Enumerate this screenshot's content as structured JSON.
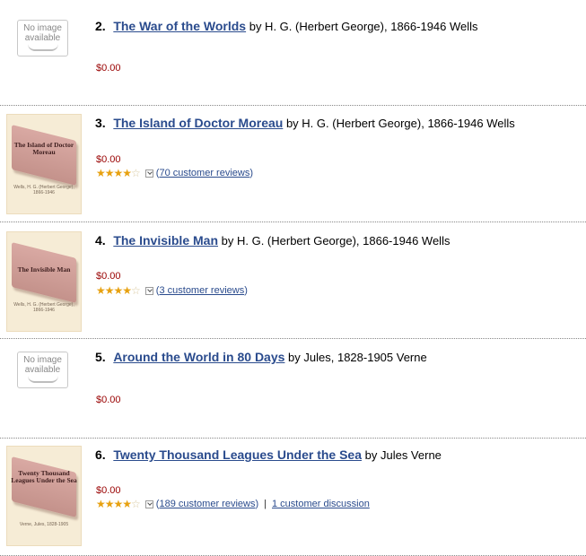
{
  "results": [
    {
      "rank": "2.",
      "title": "The War of the Worlds",
      "author": "by H. G. (Herbert George), 1866-1946 Wells",
      "price": "$0.00",
      "thumb": {
        "type": "no-image",
        "text1": "No image",
        "text2": "available"
      }
    },
    {
      "rank": "3.",
      "title": "The Island of Doctor Moreau",
      "author": "by H. G. (Herbert George), 1866-1946 Wells",
      "price": "$0.00",
      "stars": "★★★★",
      "stars_dim": "☆",
      "rating": 4.5,
      "reviews": "70 customer reviews",
      "thumb": {
        "type": "book",
        "title": "The Island of Doctor Moreau",
        "author": "Wells, H. G. (Herbert George), 1866-1946"
      }
    },
    {
      "rank": "4.",
      "title": "The Invisible Man",
      "author": "by H. G. (Herbert George), 1866-1946 Wells",
      "price": "$0.00",
      "stars": "★★★★",
      "stars_dim": "☆",
      "rating": 4.5,
      "reviews": "3 customer reviews",
      "thumb": {
        "type": "book",
        "title": "The Invisible Man",
        "author": "Wells, H. G. (Herbert George), 1866-1946"
      }
    },
    {
      "rank": "5.",
      "title": "Around the World in 80 Days",
      "author": "by Jules, 1828-1905 Verne",
      "price": "$0.00",
      "thumb": {
        "type": "no-image",
        "text1": "No image",
        "text2": "available"
      }
    },
    {
      "rank": "6.",
      "title": "Twenty Thousand Leagues Under the Sea",
      "author": "by Jules Verne",
      "price": "$0.00",
      "stars": "★★★★",
      "stars_dim": "☆",
      "rating": 4.0,
      "reviews": "189 customer reviews",
      "separator": "|",
      "discussion": "1 customer discussion",
      "thumb": {
        "type": "book",
        "title": "Twenty Thousand Leagues Under the Sea",
        "author": "Verne, Jules, 1828-1905"
      }
    }
  ],
  "colors": {
    "link": "#2a4b8d",
    "price": "#990000",
    "star": "#e7a110"
  }
}
